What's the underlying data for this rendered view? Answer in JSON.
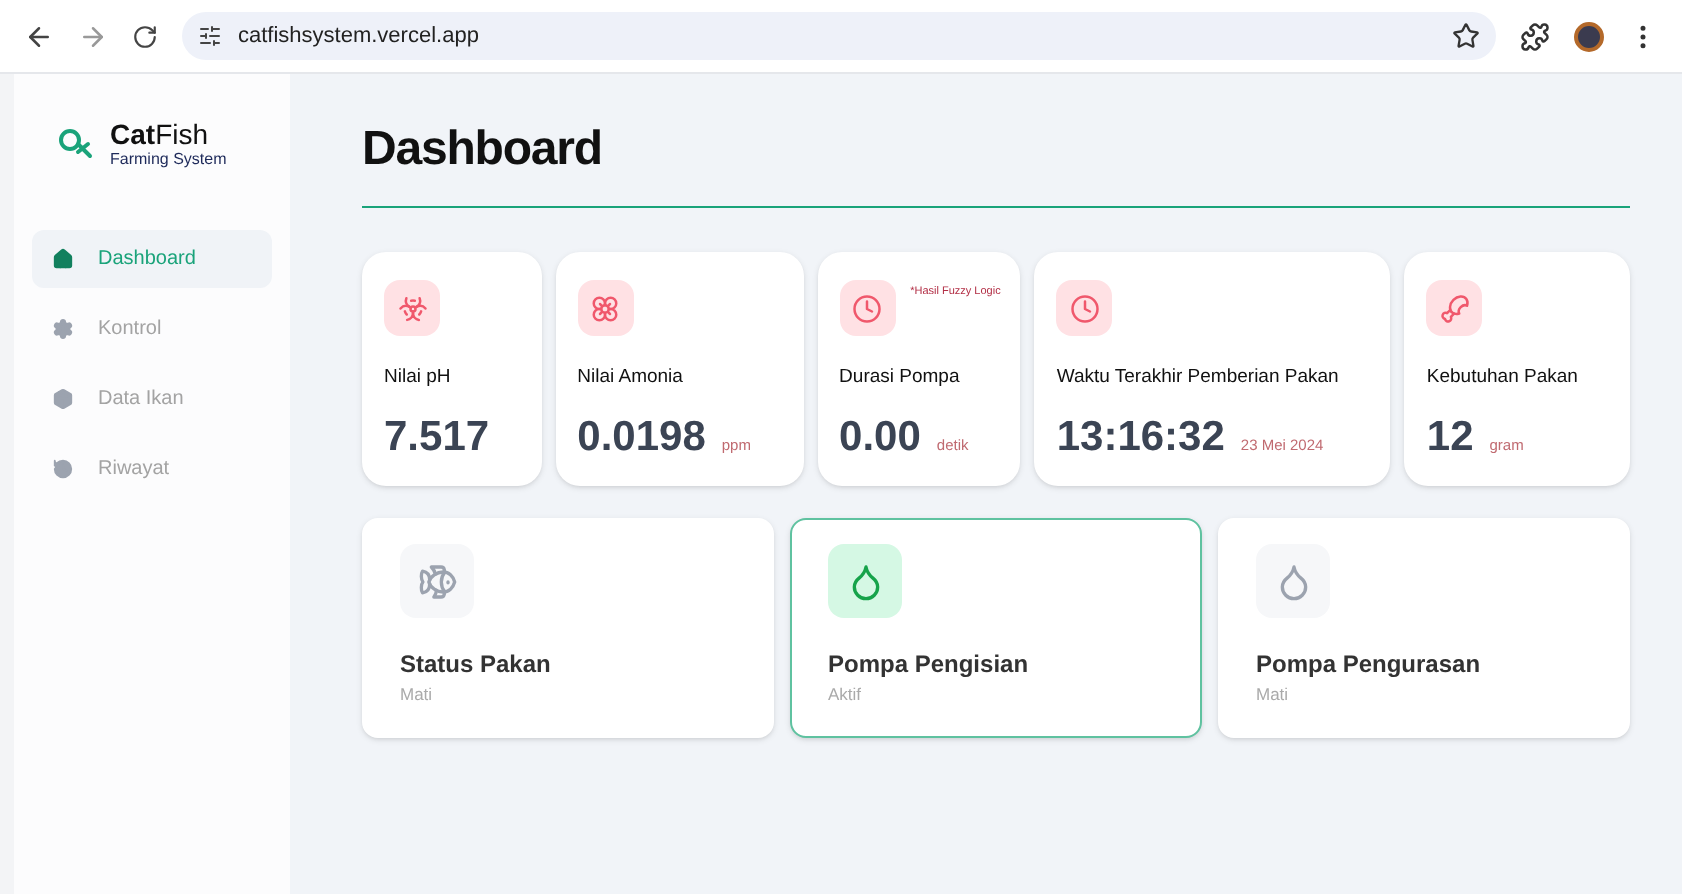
{
  "browser": {
    "url": "catfishsystem.vercel.app"
  },
  "sidebar": {
    "logo_title": "**Cat**Fish",
    "logo_subtitle": "Farming System",
    "items": [
      {
        "label": "Dashboard",
        "selected": true
      },
      {
        "label": "Kontrol",
        "selected": false
      },
      {
        "label": "Data Ikan",
        "selected": false
      },
      {
        "label": "Riwayat",
        "selected": false
      }
    ]
  },
  "page_title": "Dashboard",
  "stats": [
    {
      "label": "Nilai pH",
      "value": "7.517"
    },
    {
      "label": "Nilai Amonia",
      "value": "0.0198",
      "unit": "ppm"
    },
    {
      "label": "Durasi Pompa",
      "value": "0.00",
      "unit": "detik",
      "note": "*Hasil Fuzzy Logic"
    },
    {
      "label": "Waktu Terakhir Pemberian Pakan",
      "value": "13:16:32",
      "unit": "23 Mei 2024"
    },
    {
      "label": "Kebutuhan Pakan",
      "value": "12",
      "unit": "gram"
    }
  ],
  "statuses": [
    {
      "title": "Status Pakan",
      "state": "Mati",
      "on": false
    },
    {
      "title": "Pompa Pengisian",
      "state": "Aktif",
      "on": true
    },
    {
      "title": "Pompa Pengurasan",
      "state": "Mati",
      "on": false
    }
  ]
}
